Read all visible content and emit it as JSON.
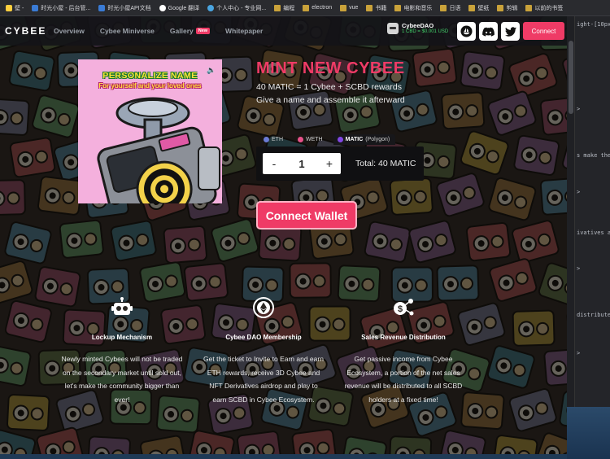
{
  "bookmarks": [
    {
      "label": "壁 -",
      "icon": "bookmark-icon"
    },
    {
      "label": "时光小屋 - 后台管...",
      "icon": "site-icon"
    },
    {
      "label": "时光小屋API文档",
      "icon": "site-icon"
    },
    {
      "label": "Google 翻译",
      "icon": "google-icon"
    },
    {
      "label": "个人中心 - 专业网...",
      "icon": "globe-icon"
    },
    {
      "label": "编程",
      "icon": "folder-icon"
    },
    {
      "label": "electron",
      "icon": "folder-icon"
    },
    {
      "label": "vue",
      "icon": "folder-icon"
    },
    {
      "label": "书籍",
      "icon": "folder-icon"
    },
    {
      "label": "电影和音乐",
      "icon": "folder-icon"
    },
    {
      "label": "日语",
      "icon": "folder-icon"
    },
    {
      "label": "壁纸",
      "icon": "folder-icon"
    },
    {
      "label": "剪辑",
      "icon": "folder-icon"
    },
    {
      "label": "以前的书签",
      "icon": "folder-icon"
    }
  ],
  "nav": {
    "logo": "CYBEE",
    "links": [
      "Overview",
      "Cybee Miniverse",
      "Gallery",
      "Whitepaper"
    ],
    "new_badge": "New",
    "dao_name": "CybeeDAO",
    "dao_rate": "1 CBD = $0.001 USD",
    "connect": "Connect"
  },
  "hero": {
    "image_title": "PERSONALIZE NAME",
    "image_subtitle": "For yourself and your loved ones",
    "title": "MINT NEW CYBEE",
    "line1": "40 MATIC = 1 Cybee + SCBD rewards",
    "line2": "Give a name and assemble it afterward"
  },
  "chains": {
    "eth": "ETH",
    "weth": "WETH",
    "matic": "MATIC",
    "matic_note": "(Polygon)"
  },
  "mint": {
    "minus": "-",
    "quantity": "1",
    "plus": "+",
    "total": "Total: 40 MATIC",
    "connect_wallet": "Connect Wallet"
  },
  "features": [
    {
      "title": "Lockup Mechanism",
      "desc": "Newly minted Cybees will not be traded on the secondary market until sold out, let's make the community bigger than ever!"
    },
    {
      "title": "Cybee DAO Membership",
      "desc": "Get the ticket to Invite to Earn and earn ETH rewards, receive 3D Cybee and NFT Derivatives airdrop and play to earn SCBD in Cybee Ecosystem."
    },
    {
      "title": "Sales Revenue Distribution",
      "desc": "Get passive income from Cybee Ecosystem, a portion of the net sales revenue will be distributed to all SCBD holders at a fixed time!"
    }
  ],
  "devtools": {
    "lines": [
      "ight-[10px",
      ">",
      "s make the",
      ">",
      "ivatives a",
      ">",
      "distribute",
      ">"
    ]
  }
}
